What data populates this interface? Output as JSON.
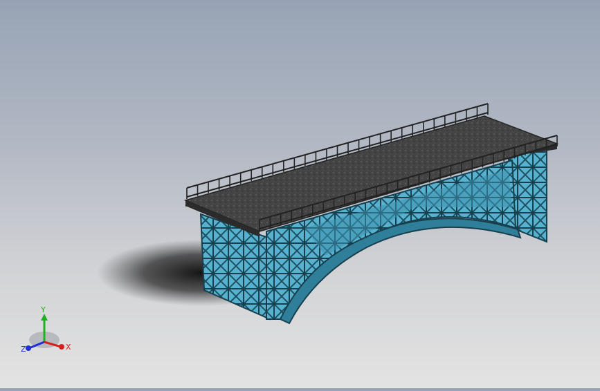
{
  "colors": {
    "background_top": "#97a3b5",
    "background_bottom": "#e3e3e3",
    "deck_surface": "#3c3c3c",
    "steel_frame": "#4aa6c4",
    "steel_edge": "#1c4f60",
    "railing": "#2a2a2a",
    "axis_x": "#d42020",
    "axis_y": "#20b020",
    "axis_z": "#2030d0"
  },
  "triad": {
    "x_label": "X",
    "y_label": "Y",
    "z_label": "Z"
  }
}
